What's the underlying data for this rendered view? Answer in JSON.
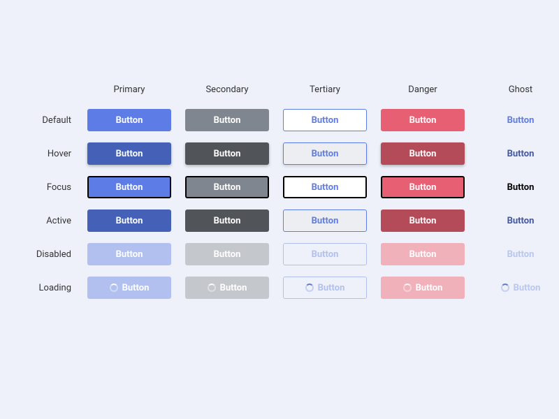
{
  "columns": [
    "Primary",
    "Secondary",
    "Tertiary",
    "Danger",
    "Ghost"
  ],
  "rows": [
    "Default",
    "Hover",
    "Focus",
    "Active",
    "Disabled",
    "Loading"
  ],
  "button_label": "Button",
  "colors": {
    "primary": "#5d7ce5",
    "primary_hover": "#4560b7",
    "primary_disabled": "#b1c0ef",
    "secondary": "#80868f",
    "secondary_hover": "#515459",
    "secondary_disabled": "#c4c7cc",
    "tertiary_border": "#5d7ce5",
    "tertiary_text": "#5d7ce5",
    "tertiary_hover_bg": "#eceef2",
    "tertiary_disabled": "#b1c0ef",
    "danger": "#e75f73",
    "danger_hover": "#b34b58",
    "danger_disabled": "#f0b1bb",
    "ghost_text": "#5d7ce5",
    "ghost_hover": "#3f57a5",
    "ghost_focus": "#000000",
    "ghost_disabled": "#b9c6ef",
    "focus_outline": "#000000"
  }
}
